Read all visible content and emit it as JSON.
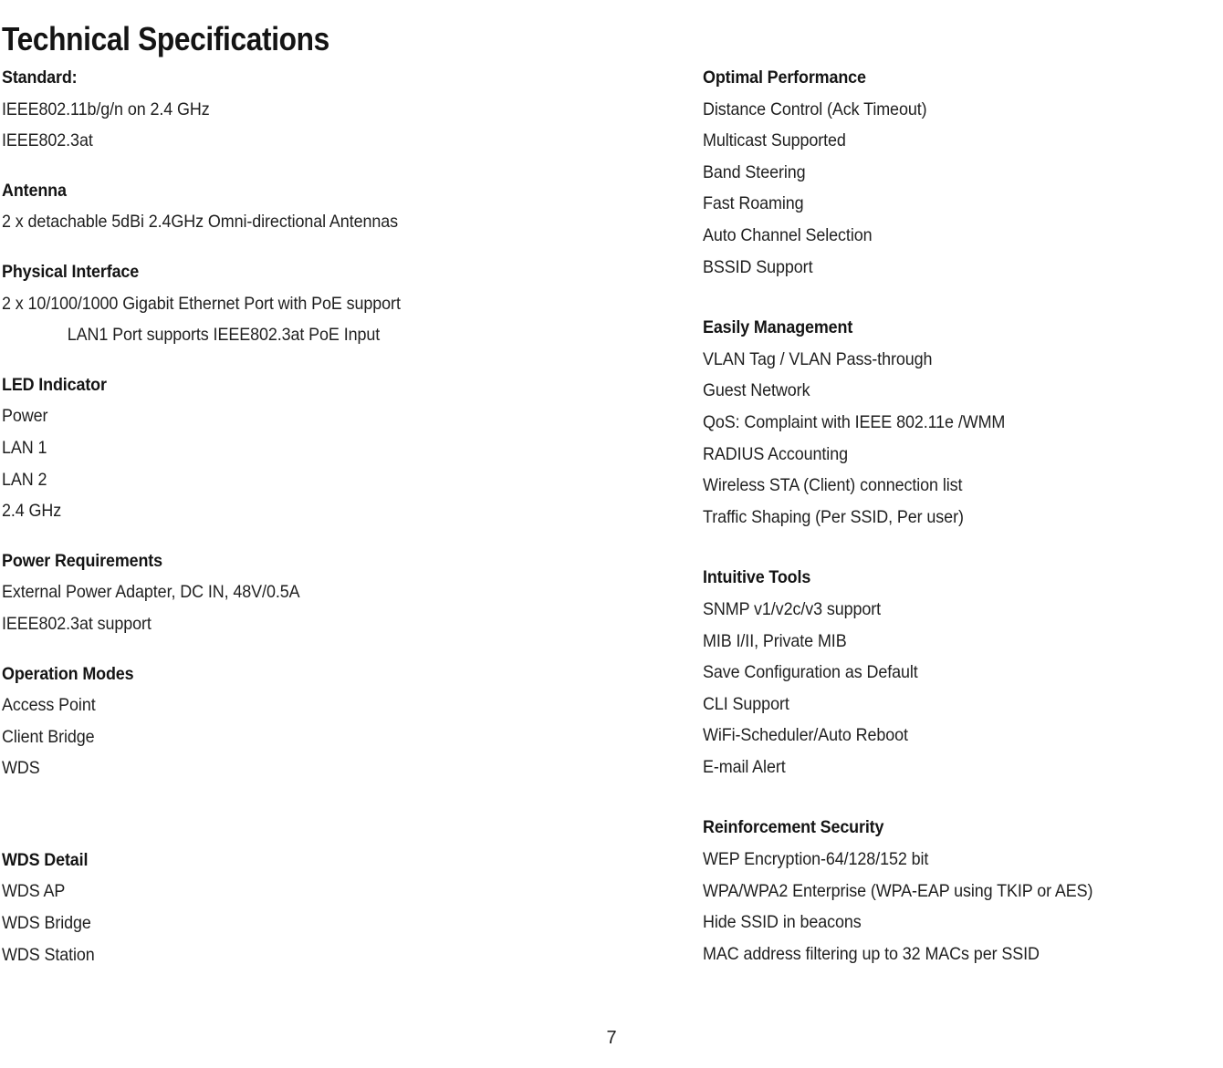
{
  "document": {
    "title": "Technical Specifications",
    "page_number": "7"
  },
  "left_column": {
    "sections": [
      {
        "heading": "Standard:",
        "lines": [
          {
            "text": "IEEE802.11b/g/n on 2.4 GHz",
            "indent": false
          },
          {
            "text": "IEEE802.3at",
            "indent": false
          }
        ]
      },
      {
        "heading": "Antenna",
        "lines": [
          {
            "text": "2 x detachable 5dBi 2.4GHz Omni-directional Antennas",
            "indent": false
          }
        ]
      },
      {
        "heading": "Physical Interface",
        "lines": [
          {
            "text": "2 x 10/100/1000 Gigabit Ethernet Port with PoE support",
            "indent": false
          },
          {
            "text": "LAN1 Port supports IEEE802.3at PoE Input",
            "indent": true
          }
        ]
      },
      {
        "heading": "LED Indicator",
        "lines": [
          {
            "text": "Power",
            "indent": false
          },
          {
            "text": "LAN 1",
            "indent": false
          },
          {
            "text": "LAN 2",
            "indent": false
          },
          {
            "text": "2.4 GHz",
            "indent": false
          }
        ]
      },
      {
        "heading": "Power Requirements",
        "lines": [
          {
            "text": "External Power Adapter, DC IN, 48V/0.5A",
            "indent": false
          },
          {
            "text": "IEEE802.3at support",
            "indent": false
          }
        ]
      },
      {
        "heading": "Operation Modes",
        "lines": [
          {
            "text": "Access Point",
            "indent": false
          },
          {
            "text": "Client Bridge",
            "indent": false
          },
          {
            "text": "WDS",
            "indent": false
          }
        ]
      },
      {
        "heading": "WDS Detail",
        "lines": [
          {
            "text": "WDS AP",
            "indent": false
          },
          {
            "text": "WDS Bridge",
            "indent": false
          },
          {
            "text": "WDS Station",
            "indent": false
          }
        ]
      }
    ]
  },
  "right_column": {
    "sections": [
      {
        "heading": "Optimal Performance",
        "lines": [
          {
            "text": "Distance Control (Ack Timeout)",
            "indent": false
          },
          {
            "text": "Multicast Supported",
            "indent": false
          },
          {
            "text": "Band Steering",
            "indent": false
          },
          {
            "text": "Fast Roaming",
            "indent": false
          },
          {
            "text": "Auto Channel Selection",
            "indent": false
          },
          {
            "text": "BSSID Support",
            "indent": false
          }
        ]
      },
      {
        "heading": "Easily Management",
        "lines": [
          {
            "text": "VLAN Tag / VLAN Pass-through",
            "indent": false
          },
          {
            "text": "Guest Network",
            "indent": false
          },
          {
            "text": "QoS: Complaint with IEEE 802.11e /WMM",
            "indent": false
          },
          {
            "text": "RADIUS Accounting",
            "indent": false
          },
          {
            "text": "Wireless STA (Client) connection list",
            "indent": false
          },
          {
            "text": "Traffic Shaping (Per SSID, Per user)",
            "indent": false
          }
        ]
      },
      {
        "heading": "Intuitive Tools",
        "lines": [
          {
            "text": "SNMP v1/v2c/v3 support",
            "indent": false
          },
          {
            "text": "MIB I/II, Private MIB",
            "indent": false
          },
          {
            "text": "Save Configuration as Default",
            "indent": false
          },
          {
            "text": "CLI Support",
            "indent": false
          },
          {
            "text": "WiFi-Scheduler/Auto Reboot",
            "indent": false
          },
          {
            "text": "E-mail Alert",
            "indent": false
          }
        ]
      },
      {
        "heading": "Reinforcement Security",
        "lines": [
          {
            "text": "WEP Encryption-64/128/152 bit",
            "indent": false
          },
          {
            "text": "WPA/WPA2 Enterprise (WPA-EAP using TKIP or AES)",
            "indent": false
          },
          {
            "text": "Hide SSID in beacons",
            "indent": false
          },
          {
            "text": "MAC address filtering up to 32 MACs per SSID",
            "indent": false
          }
        ]
      }
    ]
  }
}
